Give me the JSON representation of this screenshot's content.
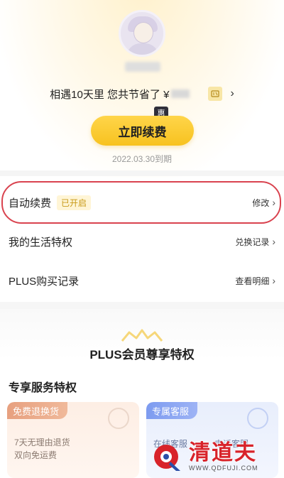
{
  "header": {
    "username_hidden": "",
    "saved_text": "相遇10天里 您共节省了 ¥",
    "saved_amount_hidden": "",
    "coupon_icon": "coupon-icon",
    "badge": "惠",
    "renew_label": "立即续费",
    "expiry": "2022.03.30到期"
  },
  "settings": {
    "auto_renew": {
      "label": "自动续费",
      "status": "已开启",
      "action": "修改"
    },
    "life_privileges": {
      "label": "我的生活特权",
      "action": "兑换记录"
    },
    "plus_purchase": {
      "label": "PLUS购买记录",
      "action": "查看明细"
    }
  },
  "plus_section": {
    "title": "PLUS会员尊享特权",
    "subtitle": "专享服务特权",
    "cards": [
      {
        "tag": "免费退换货",
        "lines": [
          "7天无理由退货",
          "双向免运费"
        ]
      },
      {
        "tag": "专属客服",
        "items": [
          "在线客服",
          "电话客服"
        ]
      }
    ]
  },
  "watermark": {
    "name": "清道夫",
    "url": "WWW.QDFUJI.COM"
  },
  "colors": {
    "accent": "#f7c21f",
    "highlight": "#d9434f",
    "brand_red": "#d8232a"
  }
}
